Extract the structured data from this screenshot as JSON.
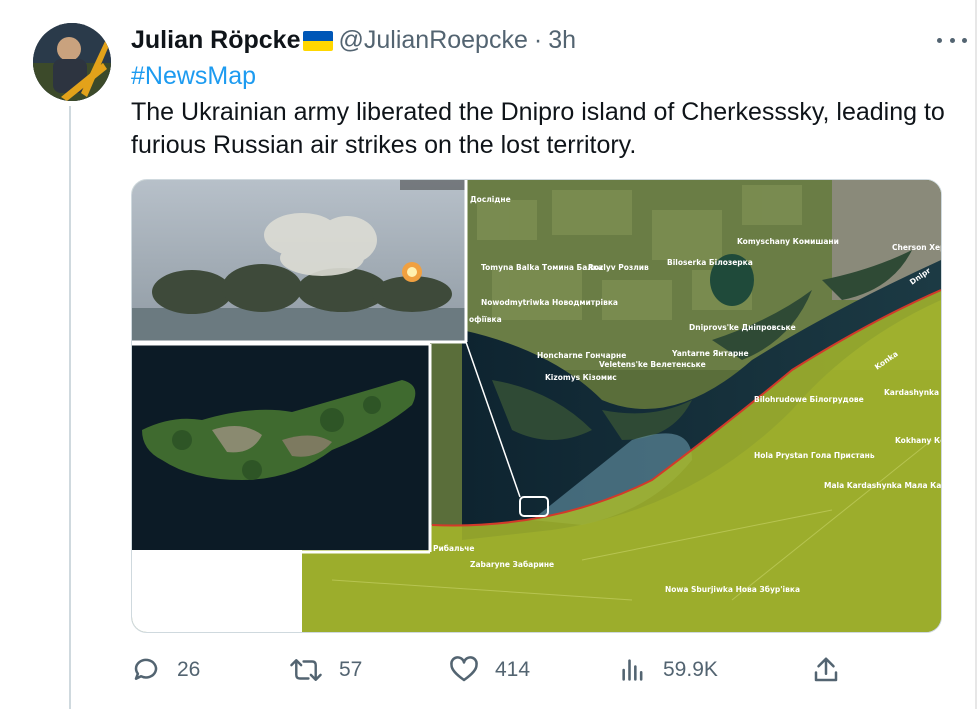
{
  "tweet": {
    "author_name": "Julian Röpcke",
    "handle": "@JulianRoepcke",
    "separator": "·",
    "time": "3h",
    "hashtag": "#NewsMap",
    "text_line1": "The Ukrainian army liberated the Dnipro island of Cherkesssky, leading to",
    "text_line2": "furious Russian air strikes on the lost territory."
  },
  "actions": {
    "replies": "26",
    "retweets": "57",
    "likes": "414",
    "views": "59.9K"
  },
  "map_labels": {
    "doslidne": "Дослідне",
    "komyschany": "Komyschany Комишани",
    "cherson": "Cherson Херсон",
    "tomyna": "Tomyna Balka Томина Балка",
    "rozliv": "Rozlyv Розлив",
    "biloserka": "Biloserka Білозерка",
    "dnipr": "Dnipr",
    "nowodmytriwka": "Nowodmytriwka Новодмитрівка",
    "sofiivka": "офіївка",
    "dniprovske": "Dniprovs'ke Дніпровське",
    "konka": "Konka",
    "honcharne": "Honcharne Гончарне",
    "yantarne": "Yantarne Янтарне",
    "veletenske": "Veletens'ke Велетенське",
    "kardashynka": "Kardashynka Кардаш",
    "kizomys": "Kizomys Кізомис",
    "bilohrudowe": "Bilohrudowe Білогрудове",
    "kokhany": "Kokhany Кохани",
    "hola_prystan": "Hola Prystan Гола Пристань",
    "mala_kardashynka": "Mala Kardashynka Мала Кардашинка",
    "rybalche": "Рибальче",
    "zabaryne": "Zabaryne Забарине",
    "nowa_sburjiwka": "Nowa Sburjiwka Нова Збур'івка"
  },
  "colors": {
    "link": "#1d9bf0",
    "muted": "#536471",
    "occupied": "#a8b82a",
    "front_line": "#d23a2a"
  }
}
